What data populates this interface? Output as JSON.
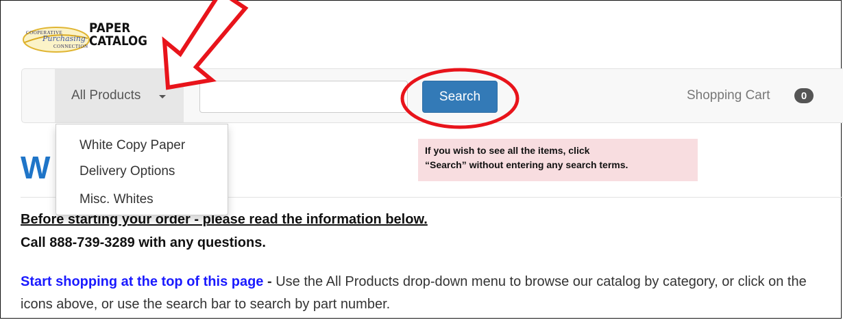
{
  "logo": {
    "small_top": "COOPERATIVE",
    "script": "Purchasing",
    "small_bottom": "CONNECTION",
    "title_line1": "PAPER",
    "title_line2": "CATALOG"
  },
  "navbar": {
    "dropdown_label": "All Products",
    "search_input_value": "",
    "search_button": "Search",
    "cart_label": "Shopping Cart",
    "cart_count": "0"
  },
  "dropdown": {
    "items": [
      {
        "label": "White Copy Paper"
      },
      {
        "label": "Delivery Options"
      },
      {
        "label": "Misc. Whites"
      }
    ]
  },
  "main": {
    "heading_visible": "W",
    "before_line": "Before starting your order - please read the information below.",
    "call_line": "Call 888-739-3289 with any questions.",
    "link_text": "Start shopping at the top of this page",
    "dash": " - ",
    "paragraph_rest": "Use the All Products drop-down menu to browse our catalog by category, or click on the icons above, or use the search bar to search by part number."
  },
  "annotation": {
    "note_line1": "If you wish to see all the items, click",
    "note_line2": "“Search” without entering any search terms.",
    "arrow_color": "#e8141b",
    "circle_color": "#e8141b"
  },
  "colors": {
    "search_button": "#337ab7",
    "heading": "#1f75c8",
    "link": "#1a1aff",
    "note_bg": "#f8dde0"
  }
}
